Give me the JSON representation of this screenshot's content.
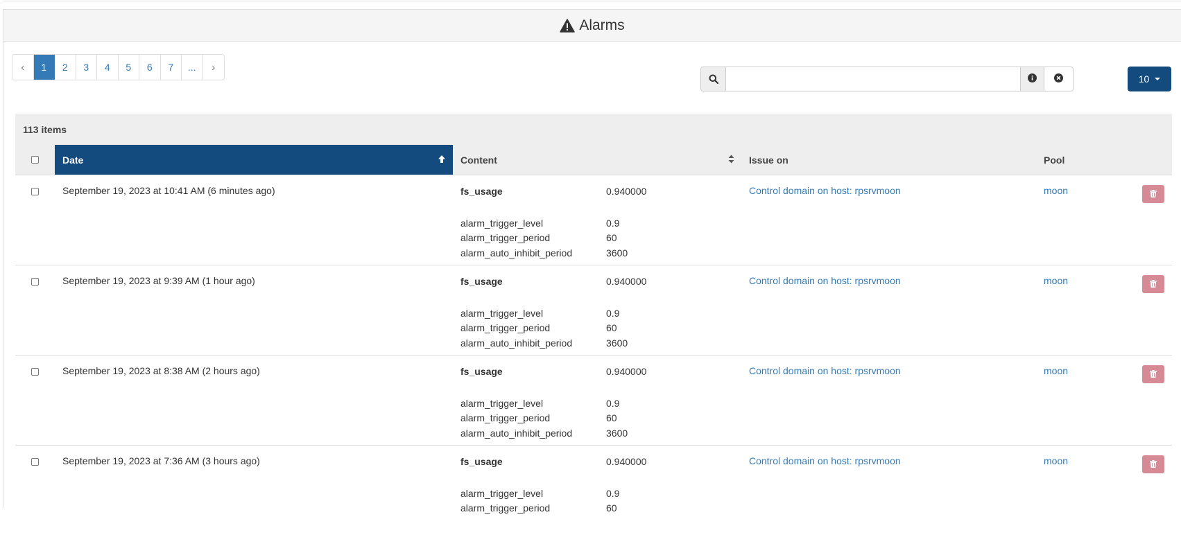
{
  "panel": {
    "title": "Alarms",
    "title_icon": "warning-triangle-icon"
  },
  "pagination": {
    "prev": "‹",
    "next": "›",
    "pages": [
      "1",
      "2",
      "3",
      "4",
      "5",
      "6",
      "7",
      "..."
    ],
    "active": "1"
  },
  "search": {
    "value": "",
    "search_icon": "search-icon",
    "info_icon": "info-icon",
    "clear_icon": "clear-circle-icon"
  },
  "per_page": {
    "value": "10"
  },
  "table": {
    "count_label": "113 items",
    "headers": {
      "date": "Date",
      "content": "Content",
      "issue_on": "Issue on",
      "pool": "Pool"
    },
    "sort": {
      "date": "ascending",
      "content": "unsorted"
    },
    "rows": [
      {
        "date": "September 19, 2023 at 10:41 AM (6 minutes ago)",
        "metric": "fs_usage",
        "metric_value": "0.940000",
        "params": [
          {
            "k": "alarm_trigger_level",
            "v": "0.9"
          },
          {
            "k": "alarm_trigger_period",
            "v": "60"
          },
          {
            "k": "alarm_auto_inhibit_period",
            "v": "3600"
          }
        ],
        "issue_on": "Control domain on host: rpsrvmoon",
        "pool": "moon"
      },
      {
        "date": "September 19, 2023 at 9:39 AM (1 hour ago)",
        "metric": "fs_usage",
        "metric_value": "0.940000",
        "params": [
          {
            "k": "alarm_trigger_level",
            "v": "0.9"
          },
          {
            "k": "alarm_trigger_period",
            "v": "60"
          },
          {
            "k": "alarm_auto_inhibit_period",
            "v": "3600"
          }
        ],
        "issue_on": "Control domain on host: rpsrvmoon",
        "pool": "moon"
      },
      {
        "date": "September 19, 2023 at 8:38 AM (2 hours ago)",
        "metric": "fs_usage",
        "metric_value": "0.940000",
        "params": [
          {
            "k": "alarm_trigger_level",
            "v": "0.9"
          },
          {
            "k": "alarm_trigger_period",
            "v": "60"
          },
          {
            "k": "alarm_auto_inhibit_period",
            "v": "3600"
          }
        ],
        "issue_on": "Control domain on host: rpsrvmoon",
        "pool": "moon"
      },
      {
        "date": "September 19, 2023 at 7:36 AM (3 hours ago)",
        "metric": "fs_usage",
        "metric_value": "0.940000",
        "params": [
          {
            "k": "alarm_trigger_level",
            "v": "0.9"
          },
          {
            "k": "alarm_trigger_period",
            "v": "60"
          }
        ],
        "issue_on": "Control domain on host: rpsrvmoon",
        "pool": "moon"
      }
    ]
  },
  "colors": {
    "primary": "#134b7e",
    "link": "#337ab7",
    "danger_light": "#d68a95"
  }
}
